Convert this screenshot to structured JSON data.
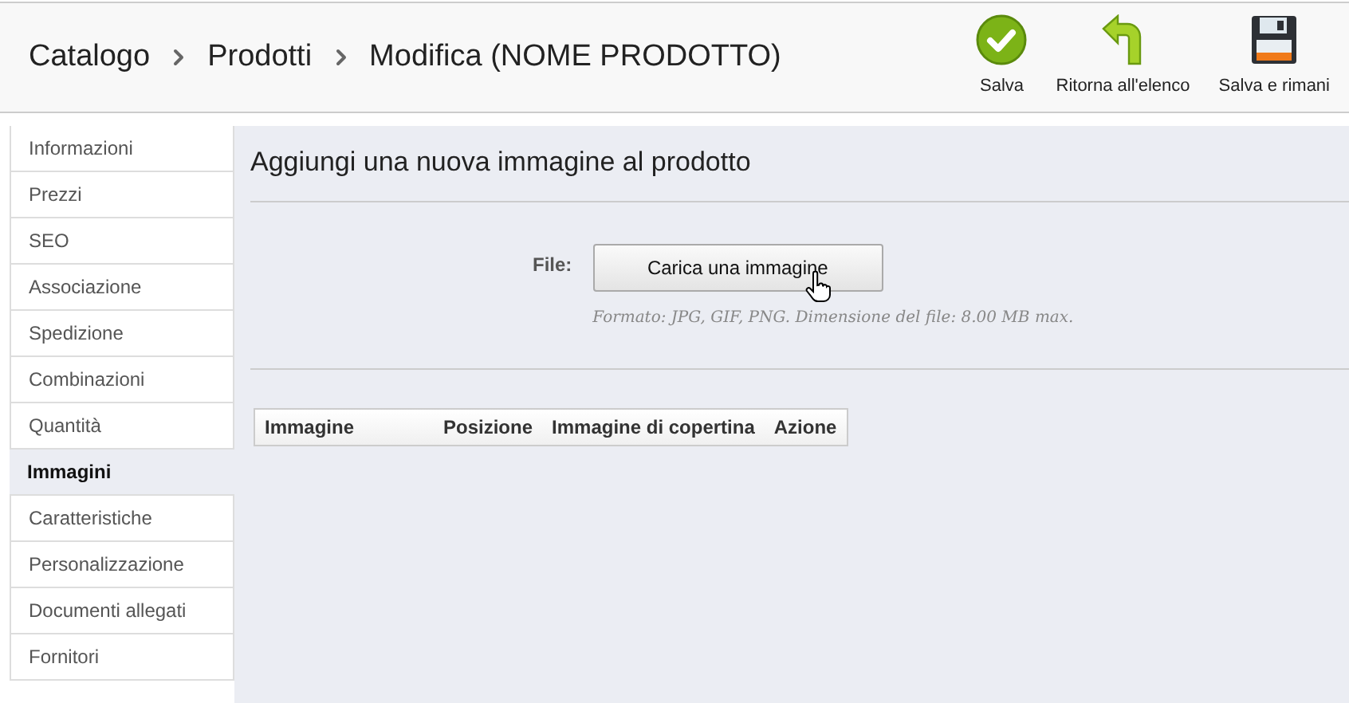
{
  "breadcrumb": [
    "Catalogo",
    "Prodotti",
    "Modifica (NOME PRODOTTO)"
  ],
  "toolbar": [
    {
      "kind": "save",
      "label": "Salva"
    },
    {
      "kind": "back",
      "label": "Ritorna all'elenco"
    },
    {
      "kind": "stay",
      "label": "Salva e rimani"
    }
  ],
  "sidebar": {
    "items": [
      {
        "label": "Informazioni",
        "selected": false
      },
      {
        "label": "Prezzi",
        "selected": false
      },
      {
        "label": "SEO",
        "selected": false
      },
      {
        "label": "Associazione",
        "selected": false
      },
      {
        "label": "Spedizione",
        "selected": false
      },
      {
        "label": "Combinazioni",
        "selected": false
      },
      {
        "label": "Quantità",
        "selected": false
      },
      {
        "label": "Immagini",
        "selected": true
      },
      {
        "label": "Caratteristiche",
        "selected": false
      },
      {
        "label": "Personalizzazione",
        "selected": false
      },
      {
        "label": "Documenti allegati",
        "selected": false
      },
      {
        "label": "Fornitori",
        "selected": false
      }
    ]
  },
  "panel": {
    "title": "Aggiungi una nuova immagine al prodotto",
    "file_label": "File:",
    "upload_button": "Carica una immagine",
    "hint": "Formato: JPG, GIF, PNG. Dimensione del file: 8.00 MB max."
  },
  "table": {
    "columns": [
      "Immagine",
      "Posizione",
      "Immagine di copertina",
      "Azione"
    ]
  }
}
